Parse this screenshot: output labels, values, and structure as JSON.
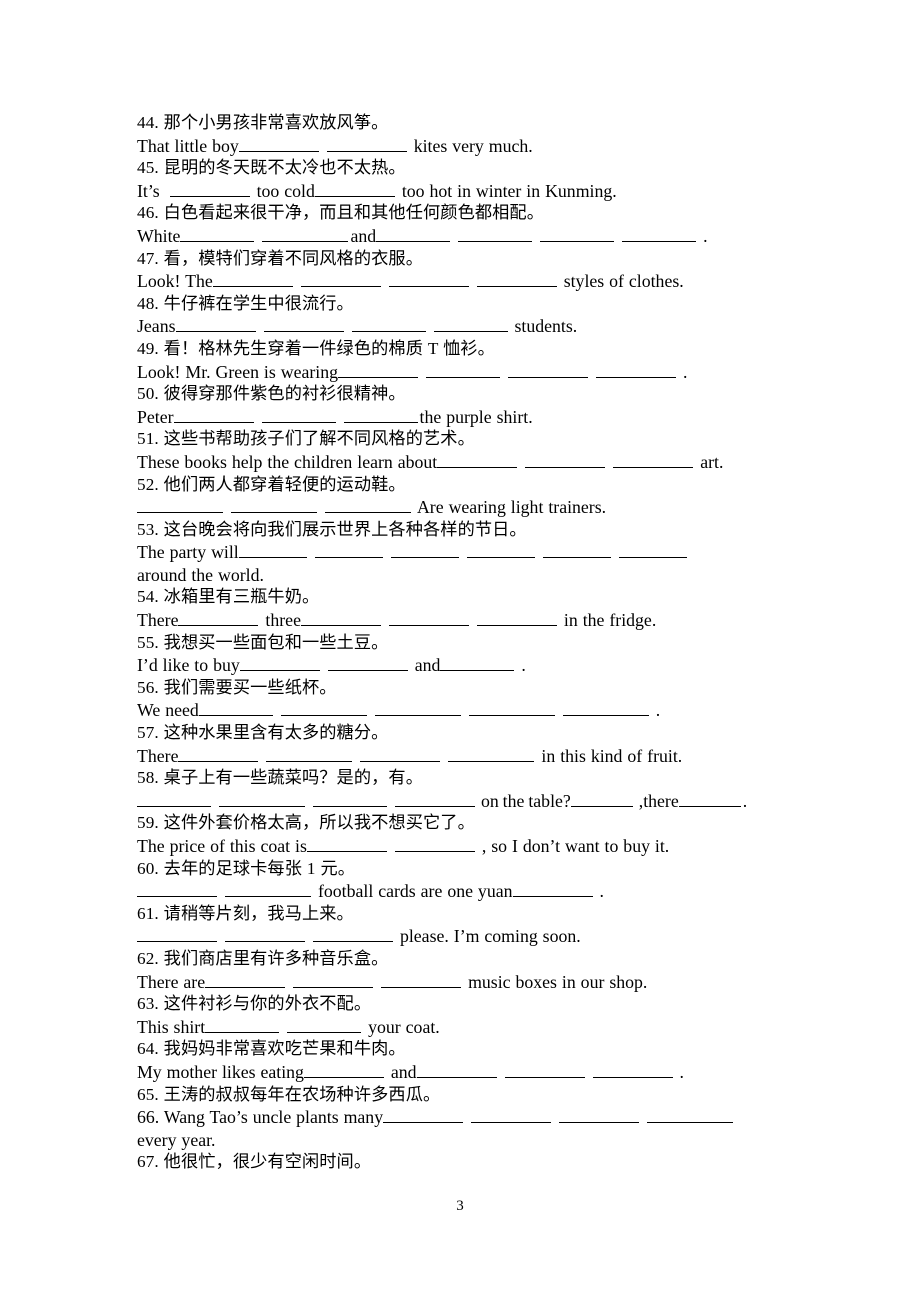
{
  "document": {
    "page_number": "3",
    "type": "translation-fill-in-the-blank-worksheet"
  },
  "items": [
    {
      "id": "44",
      "chinese": "44. 那个小男孩非常喜欢放风筝。",
      "english_prefix": "That little boy",
      "english_mid": "",
      "english_suffix": "kites very much.",
      "blanks": 2
    },
    {
      "id": "45",
      "chinese": "45. 昆明的冬天既不太冷也不太热。",
      "english_prefix": "It’s",
      "english_mid": "too cold",
      "english_suffix": "too hot in winter in Kunming.",
      "blanks": 2
    },
    {
      "id": "46",
      "chinese": "46. 白色看起来很干净，而且和其他任何颜色都相配。",
      "english_prefix": "White",
      "english_mid": "and",
      "english_suffix": ".",
      "blanks": 6
    },
    {
      "id": "47",
      "chinese": "47. 看，模特们穿着不同风格的衣服。",
      "english_prefix": "Look! The",
      "english_mid": "",
      "english_suffix": "styles of clothes.",
      "blanks": 4
    },
    {
      "id": "48",
      "chinese": "48. 牛仔裤在学生中很流行。",
      "english_prefix": "Jeans",
      "english_mid": "",
      "english_suffix": "students.",
      "blanks": 4
    },
    {
      "id": "49",
      "chinese": "49. 看！格林先生穿着一件绿色的棉质 T 恤衫。",
      "english_prefix": "Look! Mr. Green is wearing",
      "english_mid": "",
      "english_suffix": ".",
      "blanks": 4
    },
    {
      "id": "50",
      "chinese": "50. 彼得穿那件紫色的衬衫很精神。",
      "english_prefix": "Peter",
      "english_mid": "",
      "english_suffix": "the purple shirt.",
      "blanks": 3
    },
    {
      "id": "51",
      "chinese": "51. 这些书帮助孩子们了解不同风格的艺术。",
      "english_prefix": "These books help the children learn about",
      "english_mid": "",
      "english_suffix": "art.",
      "blanks": 3
    },
    {
      "id": "52",
      "chinese": "52. 他们两人都穿着轻便的运动鞋。",
      "english_prefix": "",
      "english_mid": "",
      "english_suffix": "Are wearing light trainers.",
      "blanks": 3
    },
    {
      "id": "53",
      "chinese": "53. 这台晚会将向我们展示世界上各种各样的节日。",
      "english_prefix": "The party will",
      "english_mid": "",
      "english_suffix": "",
      "english_second_line": "around the world.",
      "blanks": 6
    },
    {
      "id": "54",
      "chinese": "54. 冰箱里有三瓶牛奶。",
      "english_prefix": "There",
      "english_mid": "three",
      "english_suffix": "in the fridge.",
      "blanks": 4
    },
    {
      "id": "55",
      "chinese": "55. 我想买一些面包和一些土豆。",
      "english_prefix": "I’d like to buy",
      "english_mid": "and",
      "english_suffix": ".",
      "blanks": 3
    },
    {
      "id": "56",
      "chinese": "56. 我们需要买一些纸杯。",
      "english_prefix": "We need",
      "english_mid": "",
      "english_suffix": ".",
      "blanks": 5
    },
    {
      "id": "57",
      "chinese": "57. 这种水果里含有太多的糖分。",
      "english_prefix": "There",
      "english_mid": "",
      "english_suffix": "in this kind of fruit.",
      "blanks": 4
    },
    {
      "id": "58",
      "chinese": "58. 桌子上有一些蔬菜吗？是的，有。",
      "english_prefix": "",
      "english_mid": "on the table?",
      "english_mid2": ",there",
      "english_suffix": ".",
      "blanks": 4
    },
    {
      "id": "59",
      "chinese": "59. 这件外套价格太高，所以我不想买它了。",
      "english_prefix": "The price of this coat is",
      "english_mid": "",
      "english_suffix": ", so I don’t want to buy it.",
      "blanks": 2
    },
    {
      "id": "60",
      "chinese": "60. 去年的足球卡每张 1 元。",
      "english_prefix": "",
      "english_mid": "football cards are one yuan",
      "english_suffix": ".",
      "blanks": 2
    },
    {
      "id": "61",
      "chinese": "61. 请稍等片刻，我马上来。",
      "english_prefix": "",
      "english_mid": "",
      "english_suffix": "please. I’m coming soon.",
      "blanks": 3
    },
    {
      "id": "62",
      "chinese": "62. 我们商店里有许多种音乐盒。",
      "english_prefix": "There are",
      "english_mid": "",
      "english_suffix": "music boxes in our shop.",
      "blanks": 3
    },
    {
      "id": "63",
      "chinese": "63. 这件衬衫与你的外衣不配。",
      "english_prefix": "This shirt",
      "english_mid": "",
      "english_suffix": "your coat.",
      "blanks": 2
    },
    {
      "id": "64",
      "chinese": "64. 我妈妈非常喜欢吃芒果和牛肉。",
      "english_prefix": "My mother likes eating",
      "english_mid": "and",
      "english_suffix": ".",
      "blanks": 4
    },
    {
      "id": "65",
      "chinese": "65. 王涛的叔叔每年在农场种许多西瓜。",
      "english_prefix": "",
      "english_mid": "",
      "english_suffix": "",
      "blanks": 0
    },
    {
      "id": "66",
      "chinese": "",
      "english_prefix": "66. Wang Tao’s uncle plants many",
      "english_mid": "",
      "english_suffix": "",
      "english_second_line": "every year.",
      "blanks": 4
    },
    {
      "id": "67",
      "chinese": "67. 他很忙，很少有空闲时间。",
      "english_prefix": "",
      "english_mid": "",
      "english_suffix": "",
      "blanks": 0
    }
  ]
}
